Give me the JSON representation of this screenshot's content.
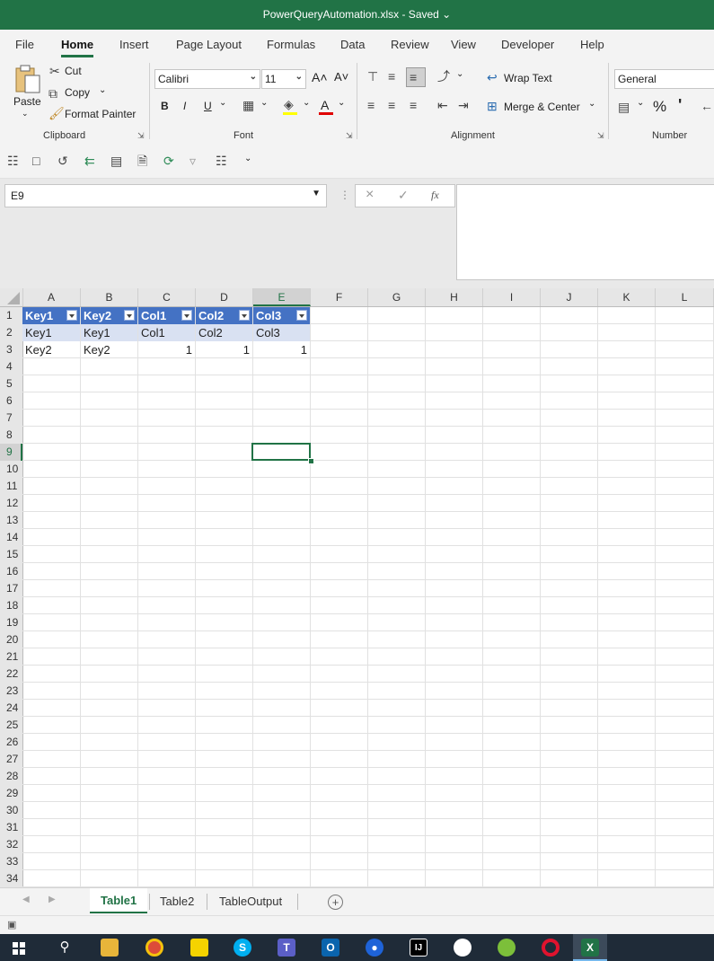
{
  "window": {
    "title": "PowerQueryAutomation.xlsx  -  Saved  ⌄"
  },
  "ribbon_tabs": [
    "File",
    "Home",
    "Insert",
    "Page Layout",
    "Formulas",
    "Data",
    "Review",
    "View",
    "Developer",
    "Help"
  ],
  "active_tab": "Home",
  "clipboard": {
    "paste": "Paste",
    "cut": "Cut",
    "copy": "Copy",
    "format_painter": "Format Painter",
    "label": "Clipboard"
  },
  "font": {
    "name": "Calibri",
    "size": "11",
    "grow": "A˄",
    "shrink": "A˅",
    "bold": "B",
    "italic": "I",
    "underline": "U",
    "color": "A",
    "label": "Font"
  },
  "alignment": {
    "wrap_text": "Wrap Text",
    "merge_center": "Merge & Center",
    "label": "Alignment"
  },
  "number": {
    "format": "General",
    "percent": "%",
    "comma": "'",
    "label": "Number"
  },
  "formula_bar": {
    "name_box": "E9",
    "fx": "fx",
    "cancel": "×",
    "enter": "✓",
    "content": ""
  },
  "columns": [
    "A",
    "B",
    "C",
    "D",
    "E",
    "F",
    "G",
    "H",
    "I",
    "J",
    "K",
    "L"
  ],
  "rows": [
    "1",
    "2",
    "3",
    "4",
    "5",
    "6",
    "7",
    "8",
    "9",
    "10",
    "11",
    "12",
    "13",
    "14",
    "15",
    "16",
    "17",
    "18",
    "19",
    "20",
    "21",
    "22",
    "23",
    "24",
    "25",
    "26",
    "27",
    "28",
    "29",
    "30",
    "31",
    "32",
    "33",
    "34"
  ],
  "table": {
    "headers": [
      "Key1",
      "Key2",
      "Col1",
      "Col2",
      "Col3"
    ],
    "row2": [
      "Key1",
      "Key1",
      "Col1",
      "Col2",
      "Col3"
    ],
    "row3": [
      "Key2",
      "Key2",
      "1",
      "1",
      "1"
    ]
  },
  "selected_cell": "E9",
  "sheets": [
    "Table1",
    "Table2",
    "TableOutput"
  ],
  "active_sheet": "Table1",
  "add_sheet": "+",
  "taskbar": {
    "apps": [
      "start-icon",
      "search-icon",
      "file-explorer-icon",
      "chrome-icon",
      "sticky-notes-icon",
      "skype-icon",
      "teams-icon",
      "outlook-icon",
      "maps-icon",
      "intellij-icon",
      "inkscape-icon",
      "frog-icon",
      "opera-icon",
      "excel-icon"
    ],
    "excel": "X"
  },
  "colors": {
    "accent": "#217346",
    "table_header": "#4472c4",
    "table_band": "#d9e1f2",
    "taskbar": "#1f2b38"
  }
}
